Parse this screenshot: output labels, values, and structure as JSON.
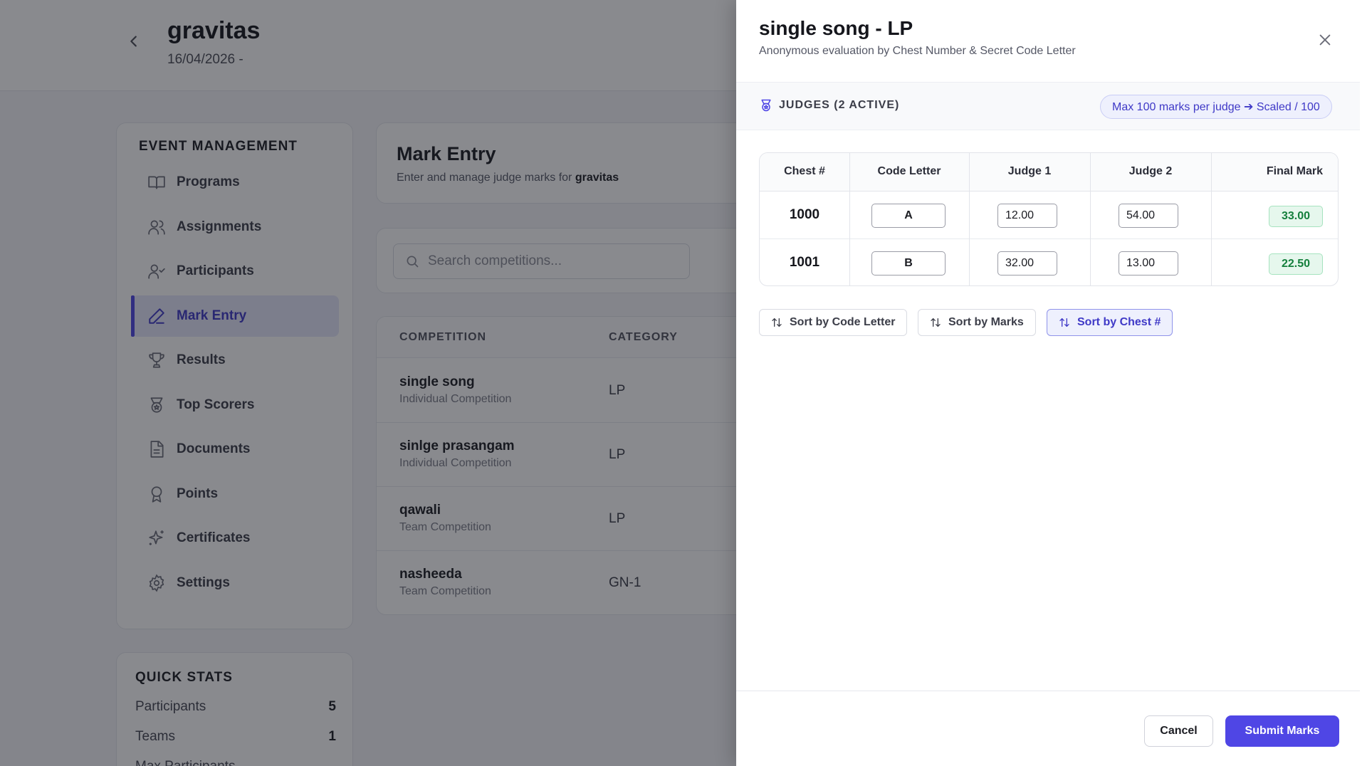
{
  "header": {
    "title": "gravitas",
    "date": "16/04/2026 -"
  },
  "sidebar": {
    "heading": "EVENT MANAGEMENT",
    "items": [
      {
        "label": "Programs",
        "icon": "book-icon"
      },
      {
        "label": "Assignments",
        "icon": "users-icon"
      },
      {
        "label": "Participants",
        "icon": "user-check-icon"
      },
      {
        "label": "Mark Entry",
        "icon": "pencil-icon",
        "active": true
      },
      {
        "label": "Results",
        "icon": "trophy-icon"
      },
      {
        "label": "Top Scorers",
        "icon": "medal-icon"
      },
      {
        "label": "Documents",
        "icon": "document-icon"
      },
      {
        "label": "Points",
        "icon": "award-icon"
      },
      {
        "label": "Certificates",
        "icon": "sparkle-icon"
      },
      {
        "label": "Settings",
        "icon": "gear-icon"
      }
    ]
  },
  "quick_stats": {
    "heading": "QUICK STATS",
    "rows": [
      {
        "label": "Participants",
        "value": "5"
      },
      {
        "label": "Teams",
        "value": "1"
      },
      {
        "label": "Max Participants",
        "value": ""
      }
    ]
  },
  "main": {
    "title": "Mark Entry",
    "subtitle_prefix": "Enter and manage judge marks for ",
    "subtitle_event": "gravitas",
    "search_placeholder": "Search competitions...",
    "columns": [
      "COMPETITION",
      "CATEGORY"
    ],
    "competitions": [
      {
        "name": "single song",
        "type": "Individual Competition",
        "category": "LP"
      },
      {
        "name": "sinlge prasangam",
        "type": "Individual Competition",
        "category": "LP"
      },
      {
        "name": "qawali",
        "type": "Team Competition",
        "category": "LP"
      },
      {
        "name": "nasheeda",
        "type": "Team Competition",
        "category": "GN-1"
      }
    ]
  },
  "drawer": {
    "title": "single song - LP",
    "subtitle": "Anonymous evaluation by Chest Number & Secret Code Letter",
    "judges_label": "JUDGES (2 ACTIVE)",
    "judges_info": "Max 100 marks per judge ➔ Scaled / 100",
    "columns": [
      "Chest #",
      "Code Letter",
      "Judge 1",
      "Judge 2",
      "Final Mark"
    ],
    "rows": [
      {
        "chest": "1000",
        "code": "A",
        "judge1": "12.00",
        "judge2": "54.00",
        "final": "33.00"
      },
      {
        "chest": "1001",
        "code": "B",
        "judge1": "32.00",
        "judge2": "13.00",
        "final": "22.50"
      }
    ],
    "sort_buttons": [
      {
        "label": "Sort by Code Letter",
        "active": false
      },
      {
        "label": "Sort by Marks",
        "active": false
      },
      {
        "label": "Sort by Chest #",
        "active": true
      }
    ],
    "cancel_label": "Cancel",
    "submit_label": "Submit Marks"
  },
  "colors": {
    "accent": "#4f46e5",
    "final_mark_green": "#15803d",
    "overlay": "rgba(20,22,30,0.5)"
  }
}
